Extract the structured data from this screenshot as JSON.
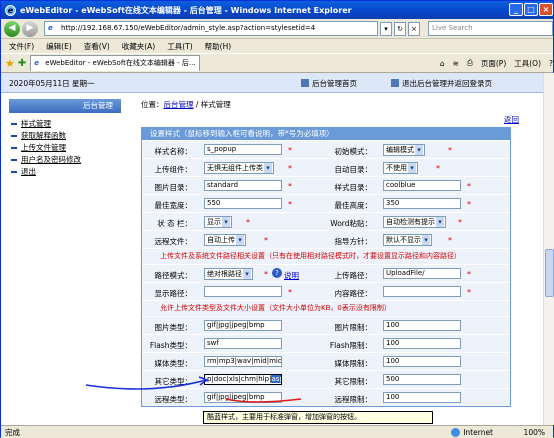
{
  "window": {
    "title": "eWebEditor - eWebSoft在线文本编辑器 - 后台管理 - Windows Internet Explorer",
    "min": "_",
    "max": "□",
    "close": "×"
  },
  "address": {
    "url": "http://192.168.67.150/eWebEditor/admin_style.asp?action=stylesetid=4",
    "search_placeholder": "Live Search"
  },
  "menu": [
    "文件(F)",
    "编辑(E)",
    "查看(V)",
    "收藏夹(A)",
    "工具(T)",
    "帮助(H)"
  ],
  "favbar": {
    "tab_title": "eWebEditor - eWebSoft在线文本编辑器 - 后...",
    "page": "页面(P)",
    "tools": "工具(O)"
  },
  "page": {
    "date": "2020年05月11日 星期一",
    "home_link": "后台管理首页",
    "logout_link": "退出后台管理并返回登录页",
    "sidebar_title": "后台管理",
    "sidebar_items": [
      "样式管理",
      "获取解释函数",
      "上传文件管理",
      "用户名及密码修改",
      "退出"
    ],
    "breadcrumb_prefix": "位置：",
    "breadcrumb_link": "后台管理",
    "breadcrumb_tail": " / 样式管理",
    "back": "返回",
    "form_title": "设置样式（鼠标移到输入框可看说明，带*号为必填项）",
    "star": "*",
    "help": "说明",
    "rows": [
      {
        "l1": "样式名称：",
        "v1": "s_popup",
        "l2": "初始模式：",
        "v2": "编辑模式"
      },
      {
        "l1": "上传组件：",
        "v1": "无惧无组件上传类",
        "l2": "自动目录：",
        "v2": "不使用"
      },
      {
        "l1": "图片目录：",
        "v1": "standard",
        "l2": "样式目录：",
        "v2": "coolblue"
      },
      {
        "l1": "最佳宽度：",
        "v1": "550",
        "l2": "最佳高度：",
        "v2": "350"
      },
      {
        "l1": "状 态 栏：",
        "v1": "显示",
        "l2": "Word粘贴：",
        "v2": "自动检测有提示"
      },
      {
        "l1": "远程文件：",
        "v1": "自动上传",
        "l2": "指导方针：",
        "v2": "默认不显示"
      }
    ],
    "note1": "上传文件及系统文件路径相关设置（只有在使用相对路径模式时，才要设置显示路径和内容路径）",
    "path_rows": [
      {
        "l1": "路径模式：",
        "v1": "绝对根路径",
        "l2": "上传路径：",
        "v2": "UploadFile/"
      },
      {
        "l1": "显示路径：",
        "v1": "",
        "l2": "内容路径：",
        "v2": ""
      }
    ],
    "note2": "允许上传文件类型及文件大小设置（文件大小单位为KB，0表示没有限制）",
    "type_rows": [
      {
        "l1": "图片类型：",
        "v1": "gif|jpg|jpeg|bmp",
        "l2": "图片限制：",
        "v2": "100"
      },
      {
        "l1": "Flash类型：",
        "v1": "swf",
        "l2": "Flash限制：",
        "v2": "100"
      },
      {
        "l1": "媒体类型：",
        "v1": "rm|mp3|wav|mid|midi|r",
        "l2": "媒体限制：",
        "v2": "100"
      },
      {
        "l1": "其它类型：",
        "v1": "p|doc|xls|chm|hlp|",
        "v1_sel": "asp",
        "l2": "其它限制：",
        "v2": "500"
      },
      {
        "l1": "远程类型：",
        "v1": "gif|jpg|jpeg|bmp",
        "l2": "远程限制：",
        "v2": "100"
      }
    ],
    "tooltip": "酷蓝样式，主要用于标准弹窗，增加弹窗的按钮。"
  },
  "status": {
    "left": "完成",
    "zone": "Internet",
    "zoom": "100%"
  }
}
